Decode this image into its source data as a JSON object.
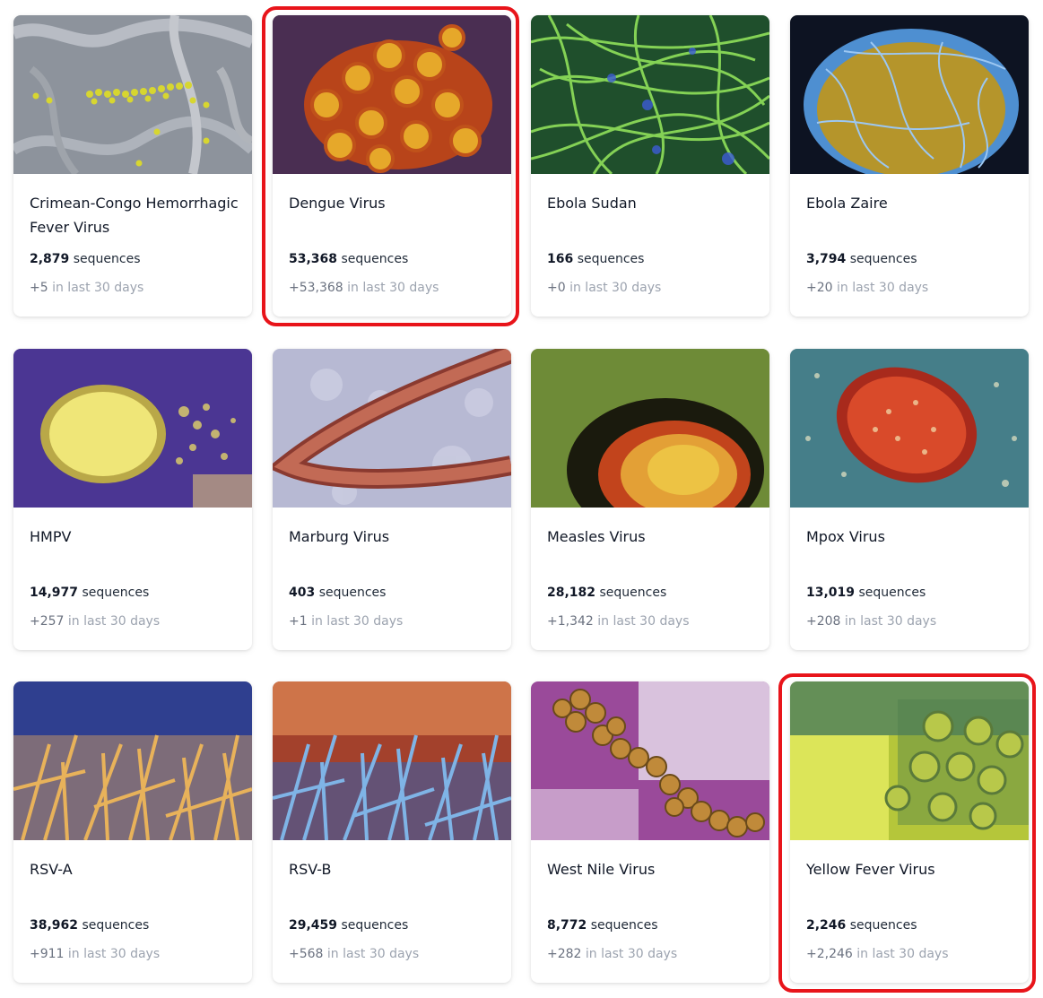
{
  "cards": [
    {
      "title": "Crimean-Congo Hemorrhagic Fever Virus",
      "count": "2,879",
      "count_unit": "sequences",
      "recent": "+5",
      "recent_suffix": "in last 30 days",
      "image": "ccHF-micrograph",
      "highlighted": false
    },
    {
      "title": "Dengue Virus",
      "count": "53,368",
      "count_unit": "sequences",
      "recent": "+53,368",
      "recent_suffix": "in last 30 days",
      "image": "dengue-micrograph",
      "highlighted": true
    },
    {
      "title": "Ebola Sudan",
      "count": "166",
      "count_unit": "sequences",
      "recent": "+0",
      "recent_suffix": "in last 30 days",
      "image": "ebola-sudan-micrograph",
      "highlighted": false
    },
    {
      "title": "Ebola Zaire",
      "count": "3,794",
      "count_unit": "sequences",
      "recent": "+20",
      "recent_suffix": "in last 30 days",
      "image": "ebola-zaire-micrograph",
      "highlighted": false
    },
    {
      "title": "HMPV",
      "count": "14,977",
      "count_unit": "sequences",
      "recent": "+257",
      "recent_suffix": "in last 30 days",
      "image": "hmpv-micrograph",
      "highlighted": false
    },
    {
      "title": "Marburg Virus",
      "count": "403",
      "count_unit": "sequences",
      "recent": "+1",
      "recent_suffix": "in last 30 days",
      "image": "marburg-micrograph",
      "highlighted": false
    },
    {
      "title": "Measles Virus",
      "count": "28,182",
      "count_unit": "sequences",
      "recent": "+1,342",
      "recent_suffix": "in last 30 days",
      "image": "measles-micrograph",
      "highlighted": false
    },
    {
      "title": "Mpox Virus",
      "count": "13,019",
      "count_unit": "sequences",
      "recent": "+208",
      "recent_suffix": "in last 30 days",
      "image": "mpox-micrograph",
      "highlighted": false
    },
    {
      "title": "RSV-A",
      "count": "38,962",
      "count_unit": "sequences",
      "recent": "+911",
      "recent_suffix": "in last 30 days",
      "image": "rsv-a-micrograph",
      "highlighted": false
    },
    {
      "title": "RSV-B",
      "count": "29,459",
      "count_unit": "sequences",
      "recent": "+568",
      "recent_suffix": "in last 30 days",
      "image": "rsv-b-micrograph",
      "highlighted": false
    },
    {
      "title": "West Nile Virus",
      "count": "8,772",
      "count_unit": "sequences",
      "recent": "+282",
      "recent_suffix": "in last 30 days",
      "image": "west-nile-micrograph",
      "highlighted": false
    },
    {
      "title": "Yellow Fever Virus",
      "count": "2,246",
      "count_unit": "sequences",
      "recent": "+2,246",
      "recent_suffix": "in last 30 days",
      "image": "yellow-fever-micrograph",
      "highlighted": true
    }
  ],
  "colors": {
    "highlight": "#e8141a",
    "title_text": "#111827",
    "muted_text": "#9ca3af"
  }
}
